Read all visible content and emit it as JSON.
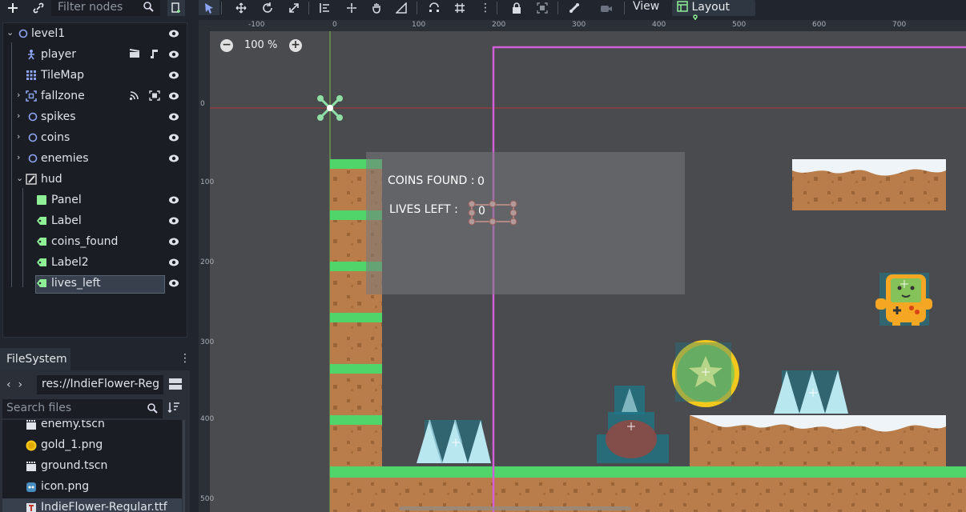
{
  "scene_toolbar": {
    "filter_placeholder": "Filter nodes"
  },
  "scene_tree": {
    "nodes": [
      {
        "label": "level1",
        "icon": "node2d-icon",
        "color": "#8da5f3"
      },
      {
        "label": "player",
        "icon": "kinematic-body-icon",
        "color": "#8da5f3"
      },
      {
        "label": "TileMap",
        "icon": "tilemap-icon",
        "color": "#8da5f3"
      },
      {
        "label": "fallzone",
        "icon": "area2d-icon",
        "color": "#8da5f3"
      },
      {
        "label": "spikes",
        "icon": "node2d-icon",
        "color": "#8da5f3"
      },
      {
        "label": "coins",
        "icon": "node2d-icon",
        "color": "#8da5f3"
      },
      {
        "label": "enemies",
        "icon": "node2d-icon",
        "color": "#8da5f3"
      },
      {
        "label": "hud",
        "icon": "canvas-layer-icon",
        "color": "#e0e0e0"
      },
      {
        "label": "Panel",
        "icon": "panel-icon",
        "color": "#8eef97"
      },
      {
        "label": "Label",
        "icon": "label-icon",
        "color": "#8eef97"
      },
      {
        "label": "coins_found",
        "icon": "label-icon",
        "color": "#8eef97"
      },
      {
        "label": "Label2",
        "icon": "label-icon",
        "color": "#8eef97"
      },
      {
        "label": "lives_left",
        "icon": "label-icon",
        "color": "#8eef97"
      }
    ]
  },
  "filesystem": {
    "tab_label": "FileSystem",
    "path": "res://IndieFlower-Reg",
    "search_placeholder": "Search files",
    "files": [
      {
        "label": "enemy.tscn",
        "icon": "scene-file-icon"
      },
      {
        "label": "gold_1.png",
        "icon": "image-file-icon"
      },
      {
        "label": "ground.tscn",
        "icon": "scene-file-icon"
      },
      {
        "label": "icon.png",
        "icon": "image-file-icon"
      },
      {
        "label": "IndieFlower-Regular.ttf",
        "icon": "font-file-icon"
      }
    ]
  },
  "toolbar": {
    "view_label": "View",
    "layout_label": "Layout"
  },
  "viewport": {
    "zoom_label": "100 %",
    "ruler_top": [
      "-100",
      "0",
      "100",
      "200",
      "300",
      "400",
      "500",
      "600",
      "700"
    ],
    "ruler_left": [
      "0",
      "100",
      "200",
      "300",
      "400",
      "500"
    ]
  },
  "hud": {
    "coins_label": "COINS FOUND :",
    "coins_value": "0",
    "lives_label": "LIVES LEFT :",
    "lives_value": "0"
  },
  "colors": {
    "accent": "#8da5f3",
    "control": "#8eef97",
    "viewport_bg": "#494b4f",
    "frame": "#d35fd8"
  }
}
